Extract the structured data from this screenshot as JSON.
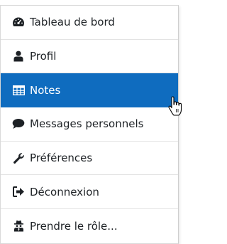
{
  "menu": {
    "items": [
      {
        "label": "Tableau de bord",
        "icon": "dashboard-icon"
      },
      {
        "label": "Profil",
        "icon": "user-icon"
      },
      {
        "label": "Notes",
        "icon": "table-icon",
        "active": true
      },
      {
        "label": "Messages personnels",
        "icon": "comment-icon"
      },
      {
        "label": "Préférences",
        "icon": "wrench-icon"
      },
      {
        "label": "Déconnexion",
        "icon": "sign-out-icon"
      },
      {
        "label": "Prendre le rôle...",
        "icon": "user-secret-icon"
      }
    ]
  },
  "colors": {
    "active_bg": "#0f6cbf",
    "text": "#1d2125",
    "border": "#d9d9d9"
  }
}
